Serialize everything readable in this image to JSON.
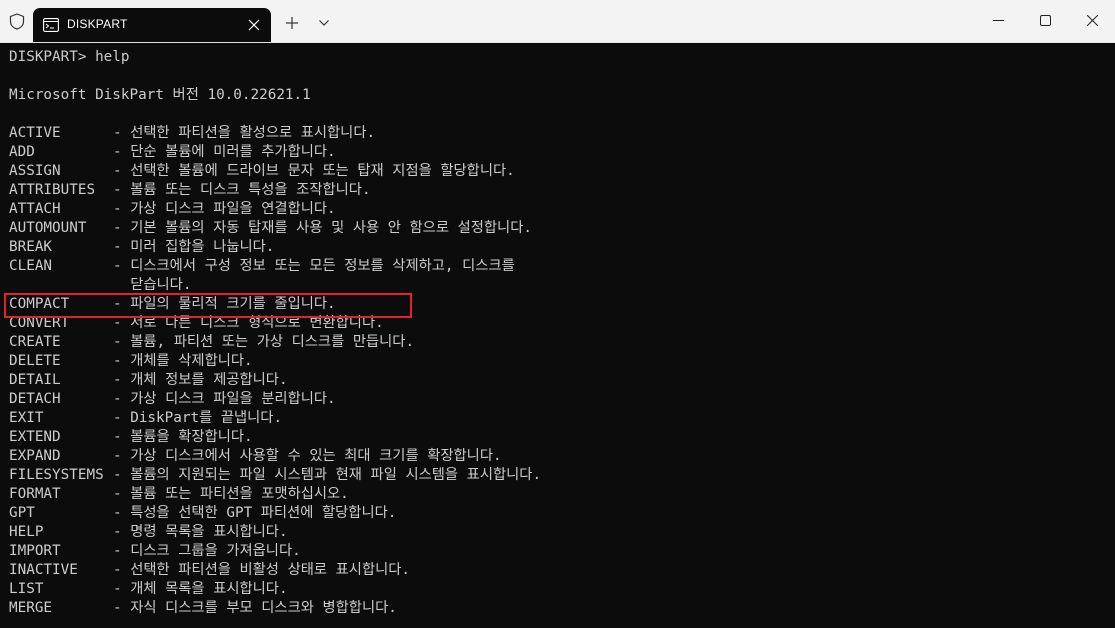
{
  "window": {
    "tab_title": "DISKPART",
    "icons": [
      "shield-icon",
      "terminal-icon",
      "close-icon",
      "plus-icon",
      "chevron-down-icon",
      "minimize-icon",
      "maximize-icon",
      "window-close-icon"
    ]
  },
  "terminal": {
    "prompt_line": "DISKPART> help",
    "version_line": "Microsoft DiskPart 버전 10.0.22621.1",
    "commands": [
      {
        "name": "ACTIVE",
        "desc": "- 선택한 파티션을 활성으로 표시합니다."
      },
      {
        "name": "ADD",
        "desc": "- 단순 볼륨에 미러를 추가합니다."
      },
      {
        "name": "ASSIGN",
        "desc": "- 선택한 볼륨에 드라이브 문자 또는 탑재 지점을 할당합니다."
      },
      {
        "name": "ATTRIBUTES",
        "desc": "- 볼륨 또는 디스크 특성을 조작합니다."
      },
      {
        "name": "ATTACH",
        "desc": "- 가상 디스크 파일을 연결합니다."
      },
      {
        "name": "AUTOMOUNT",
        "desc": "- 기본 볼륨의 자동 탑재를 사용 및 사용 안 함으로 설정합니다."
      },
      {
        "name": "BREAK",
        "desc": "- 미러 집합을 나눕니다."
      },
      {
        "name": "CLEAN",
        "desc": "- 디스크에서 구성 정보 또는 모든 정보를 삭제하고, 디스크를"
      },
      {
        "name": "",
        "desc": "  닫습니다."
      },
      {
        "name": "COMPACT",
        "desc": "- 파일의 물리적 크기를 줄입니다."
      },
      {
        "name": "CONVERT",
        "desc": "- 서로 다른 디스크 형식으로 변환합니다."
      },
      {
        "name": "CREATE",
        "desc": "- 볼륨, 파티션 또는 가상 디스크를 만듭니다."
      },
      {
        "name": "DELETE",
        "desc": "- 개체를 삭제합니다."
      },
      {
        "name": "DETAIL",
        "desc": "- 개체 정보를 제공합니다."
      },
      {
        "name": "DETACH",
        "desc": "- 가상 디스크 파일을 분리합니다."
      },
      {
        "name": "EXIT",
        "desc": "- DiskPart를 끝냅니다."
      },
      {
        "name": "EXTEND",
        "desc": "- 볼륨을 확장합니다."
      },
      {
        "name": "EXPAND",
        "desc": "- 가상 디스크에서 사용할 수 있는 최대 크기를 확장합니다."
      },
      {
        "name": "FILESYSTEMS",
        "desc": "- 볼륨의 지원되는 파일 시스템과 현재 파일 시스템을 표시합니다."
      },
      {
        "name": "FORMAT",
        "desc": "- 볼륨 또는 파티션을 포맷하십시오."
      },
      {
        "name": "GPT",
        "desc": "- 특성을 선택한 GPT 파티션에 할당합니다."
      },
      {
        "name": "HELP",
        "desc": "- 명령 목록을 표시합니다."
      },
      {
        "name": "IMPORT",
        "desc": "- 디스크 그룹을 가져옵니다."
      },
      {
        "name": "INACTIVE",
        "desc": "- 선택한 파티션을 비활성 상태로 표시합니다."
      },
      {
        "name": "LIST",
        "desc": "- 개체 목록을 표시합니다."
      },
      {
        "name": "MERGE",
        "desc": "- 자식 디스크를 부모 디스크와 병합합니다."
      }
    ]
  },
  "colors": {
    "terminal_bg": "#0c0c0c",
    "terminal_text": "#cccccc",
    "highlight_border": "#e02424",
    "titlebar_bg": "#f3f3f3"
  }
}
